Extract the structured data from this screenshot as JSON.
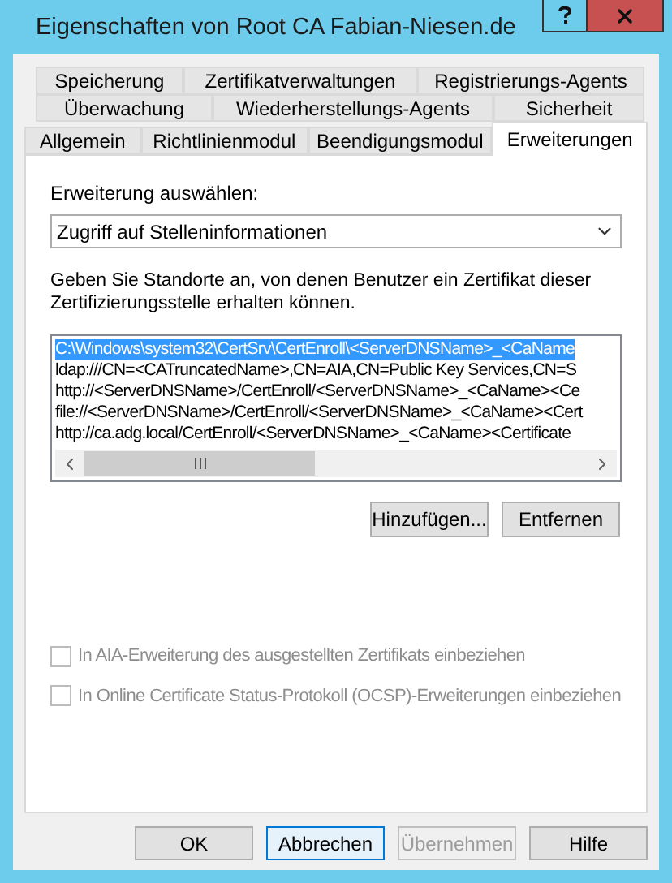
{
  "window": {
    "title": "Eigenschaften von Root CA Fabian-Niesen.de"
  },
  "tab_rows": [
    [
      {
        "label": "Speicherung",
        "selected": false
      },
      {
        "label": "Zertifikatverwaltungen",
        "selected": false
      },
      {
        "label": "Registrierungs-Agents",
        "selected": false
      }
    ],
    [
      {
        "label": "Überwachung",
        "selected": false
      },
      {
        "label": "Wiederherstellungs-Agents",
        "selected": false
      },
      {
        "label": "Sicherheit",
        "selected": false
      }
    ],
    [
      {
        "label": "Allgemein",
        "selected": false
      },
      {
        "label": "Richtlinienmodul",
        "selected": false
      },
      {
        "label": "Beendigungsmodul",
        "selected": false
      },
      {
        "label": "Erweiterungen",
        "selected": true
      }
    ]
  ],
  "extension_select": {
    "label": "Erweiterung auswählen:",
    "value": "Zugriff auf Stelleninformationen"
  },
  "description": "Geben Sie Standorte an, von denen Benutzer ein Zertifikat dieser Zertifizierungsstelle erhalten können.",
  "locations": [
    {
      "text": "C:\\Windows\\system32\\CertSrv\\CertEnroll\\<ServerDNSName>_<CaName",
      "selected": true
    },
    {
      "text": "ldap:///CN=<CATruncatedName>,CN=AIA,CN=Public Key Services,CN=S",
      "selected": false
    },
    {
      "text": "http://<ServerDNSName>/CertEnroll/<ServerDNSName>_<CaName><Ce",
      "selected": false
    },
    {
      "text": "file://<ServerDNSName>/CertEnroll/<ServerDNSName>_<CaName><Cert",
      "selected": false
    },
    {
      "text": "http://ca.adg.local/CertEnroll/<ServerDNSName>_<CaName><Certificate",
      "selected": false
    }
  ],
  "list_buttons": [
    "Hinzufügen...",
    "Entfernen"
  ],
  "options": [
    {
      "label": "In AIA-Erweiterung des ausgestellten Zertifikats einbeziehen",
      "checked": false,
      "disabled": true
    },
    {
      "label": "In Online Certificate Status-Protokoll (OCSP)-Erweiterungen einbeziehen",
      "checked": false,
      "disabled": true
    }
  ],
  "dialog_buttons": [
    {
      "label": "OK",
      "disabled": false,
      "focused": false
    },
    {
      "label": "Abbrechen",
      "disabled": false,
      "focused": true
    },
    {
      "label": "Übernehmen",
      "disabled": true,
      "focused": false
    },
    {
      "label": "Hilfe",
      "disabled": false,
      "focused": false
    }
  ]
}
